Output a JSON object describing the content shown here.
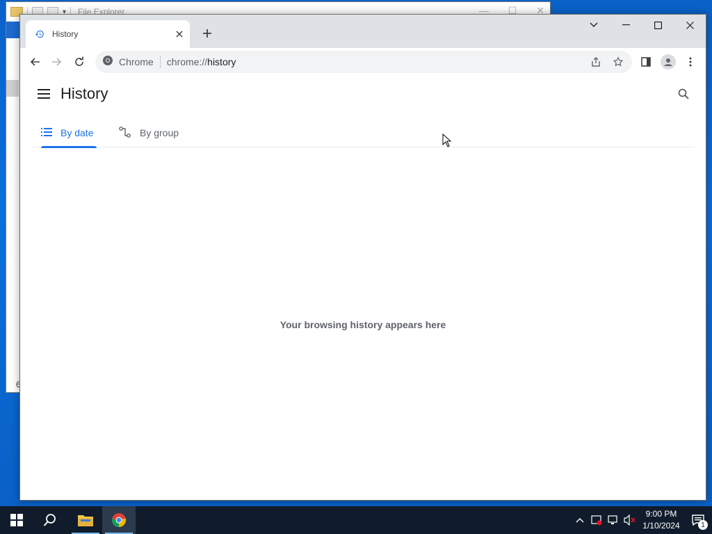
{
  "explorer": {
    "title": "File Explorer",
    "status_fragment": "6"
  },
  "browser": {
    "tab": {
      "title": "History",
      "icon": "history-icon"
    },
    "omnibox": {
      "site": "Chrome",
      "url_host": "chrome://",
      "url_path": "history"
    }
  },
  "history": {
    "title": "History",
    "tabs": [
      {
        "label": "By date",
        "icon": "list-icon",
        "active": true
      },
      {
        "label": "By group",
        "icon": "group-icon",
        "active": false
      }
    ],
    "empty_message": "Your browsing history appears here"
  },
  "taskbar": {
    "time": "9:00 PM",
    "date": "1/10/2024",
    "notification_count": "1"
  },
  "colors": {
    "accent": "#1a73e8",
    "taskbar": "#101c2b",
    "desktop": "#0b6fdc"
  }
}
